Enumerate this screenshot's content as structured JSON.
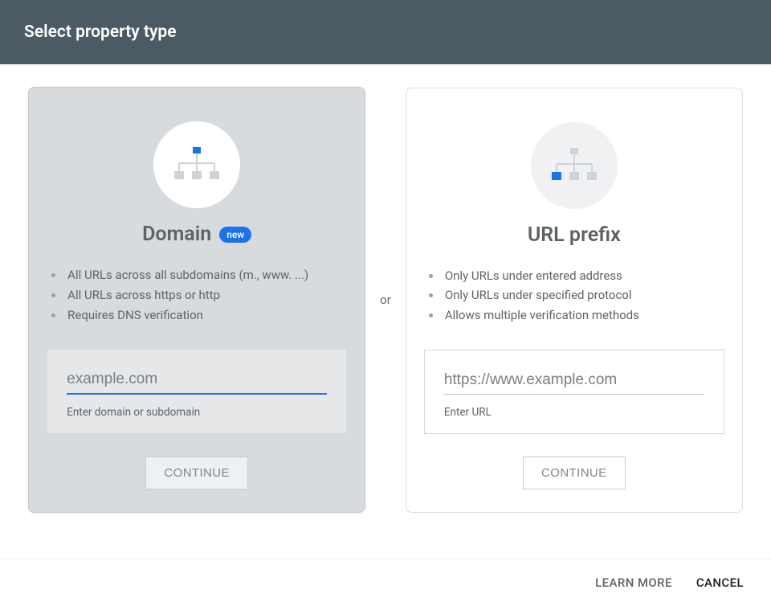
{
  "header": {
    "title": "Select property type"
  },
  "separator": "or",
  "domain_card": {
    "title": "Domain",
    "badge": "new",
    "bullets": [
      "All URLs across all subdomains (m., www. ...)",
      "All URLs across https or http",
      "Requires DNS verification"
    ],
    "input_placeholder": "example.com",
    "input_caption": "Enter domain or subdomain",
    "continue": "CONTINUE"
  },
  "urlprefix_card": {
    "title": "URL prefix",
    "bullets": [
      "Only URLs under entered address",
      "Only URLs under specified protocol",
      "Allows multiple verification methods"
    ],
    "input_placeholder": "https://www.example.com",
    "input_caption": "Enter URL",
    "continue": "CONTINUE"
  },
  "footer": {
    "learn": "LEARN MORE",
    "cancel": "CANCEL"
  }
}
